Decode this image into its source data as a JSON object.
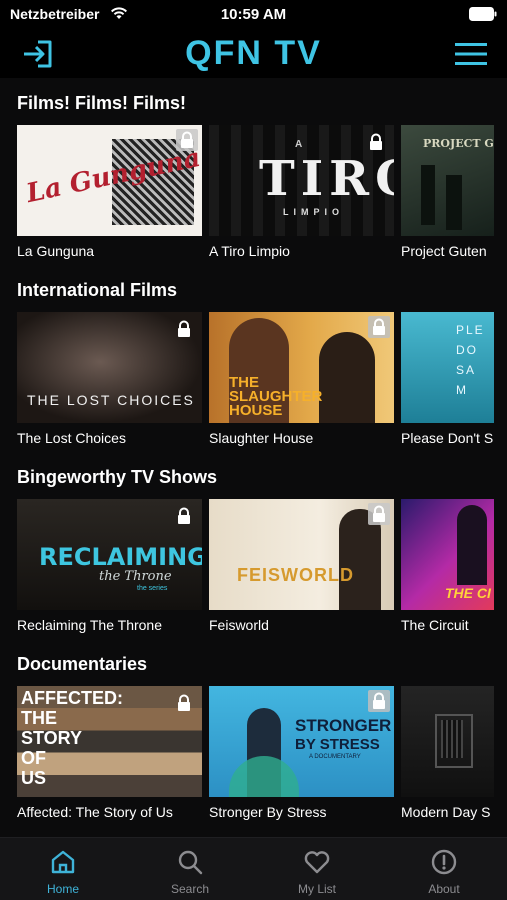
{
  "status_bar": {
    "carrier": "Netzbetreiber",
    "time": "10:59 AM"
  },
  "header": {
    "logo": "QFN TV",
    "login_icon": "login-icon",
    "menu_icon": "hamburger-menu-icon"
  },
  "colors": {
    "accent": "#3fc4e4",
    "background": "#0b0b0c",
    "tab_active": "#3fb3d8",
    "tab_inactive": "#8c8c90"
  },
  "sections": [
    {
      "title": "Films! Films! Films!",
      "items": [
        {
          "title": "La Gunguna",
          "thumb_text": "La Gunguna",
          "locked": true
        },
        {
          "title": "A Tiro Limpio",
          "thumb_text": "TIRO",
          "thumb_sub": "LIMPIO",
          "thumb_top": "A",
          "locked": true
        },
        {
          "title": "Project Guten",
          "thumb_text": "PROJECT G",
          "locked": false
        }
      ]
    },
    {
      "title": "International Films",
      "items": [
        {
          "title": "The Lost Choices",
          "thumb_text": "THE LOST CHOICES",
          "locked": true
        },
        {
          "title": "Slaughter House",
          "thumb_text": "THE SLAUGHTER HOUSE",
          "locked": true
        },
        {
          "title": "Please Don't S",
          "thumb_text": "PLE DO SA M",
          "locked": false
        }
      ]
    },
    {
      "title": "Bingeworthy TV Shows",
      "items": [
        {
          "title": "Reclaiming The Throne",
          "thumb_text": "RECLAIMING",
          "thumb_sub": "the Throne",
          "thumb_sub2": "the series",
          "locked": true
        },
        {
          "title": "Feisworld",
          "thumb_text": "FEISWORLD",
          "locked": true
        },
        {
          "title": "The Circuit",
          "thumb_text": "THE CI",
          "locked": false
        }
      ]
    },
    {
      "title": "Documentaries",
      "items": [
        {
          "title": "Affected: The Story of Us",
          "thumb_lines": [
            "AFFECTED:",
            "THE",
            "STORY",
            "OF",
            "US"
          ],
          "locked": true
        },
        {
          "title": "Stronger By Stress",
          "thumb_text": "STRONGER",
          "thumb_sub": "BY STRESS",
          "thumb_sub2": "A DOCUMENTARY",
          "locked": true
        },
        {
          "title": "Modern Day S",
          "thumb_text": "",
          "locked": false
        }
      ]
    }
  ],
  "tab_bar": [
    {
      "label": "Home",
      "icon": "home-icon",
      "active": true
    },
    {
      "label": "Search",
      "icon": "search-icon",
      "active": false
    },
    {
      "label": "My List",
      "icon": "heart-icon",
      "active": false
    },
    {
      "label": "About",
      "icon": "info-icon",
      "active": false
    }
  ]
}
